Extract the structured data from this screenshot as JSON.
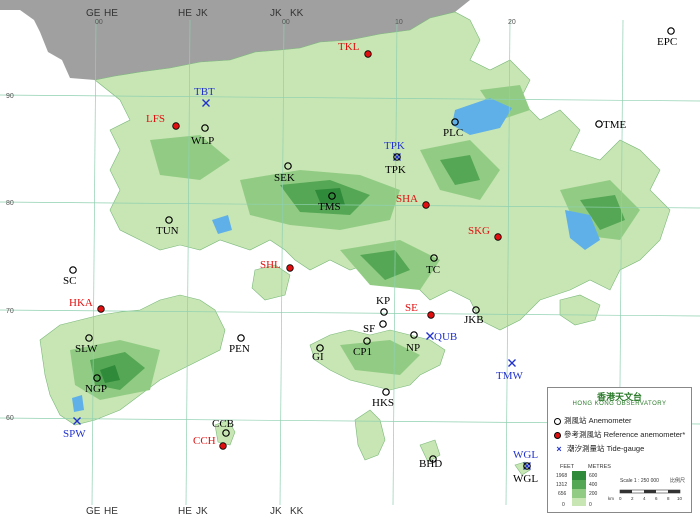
{
  "map": {
    "colors": {
      "sea": "#ffffff",
      "mainland": "#a0a0a0",
      "land_low": "#c8e6b4",
      "land_mid": "#92cc84",
      "land_high": "#55a755",
      "land_peak": "#2f8a3a",
      "reservoir": "#5fb0e8",
      "grid": "#8fd0b0",
      "anemometer": "#000000",
      "reference": "#e01010",
      "tide": "#2233cc"
    },
    "grid_top_labels": [
      "GE",
      "HE",
      "HE",
      "JK",
      "JK",
      "KK"
    ],
    "grid_bottom_labels": [
      "GE",
      "HE",
      "HE",
      "JK",
      "JK",
      "KK"
    ],
    "grid_numbers_left": [
      "90",
      "80",
      "70",
      "60"
    ],
    "grid_numbers_top": [
      "00",
      "00",
      "10",
      "20"
    ],
    "stations": [
      {
        "code": "TKL",
        "type": "reference"
      },
      {
        "code": "EPC",
        "type": "anemometer"
      },
      {
        "code": "TBT",
        "type": "tide"
      },
      {
        "code": "LFS",
        "type": "reference"
      },
      {
        "code": "WLP",
        "type": "anemometer"
      },
      {
        "code": "PLC",
        "type": "anemometer"
      },
      {
        "code": "TME",
        "type": "anemometer"
      },
      {
        "code": "TPK",
        "type": "tide"
      },
      {
        "code": "TPK",
        "type": "anemometer"
      },
      {
        "code": "SEK",
        "type": "anemometer"
      },
      {
        "code": "TMS",
        "type": "anemometer"
      },
      {
        "code": "SHA",
        "type": "reference"
      },
      {
        "code": "TUN",
        "type": "anemometer"
      },
      {
        "code": "SKG",
        "type": "reference"
      },
      {
        "code": "SHL",
        "type": "reference"
      },
      {
        "code": "TC",
        "type": "anemometer"
      },
      {
        "code": "SC",
        "type": "anemometer"
      },
      {
        "code": "HKA",
        "type": "reference"
      },
      {
        "code": "KP",
        "type": "anemometer"
      },
      {
        "code": "SE",
        "type": "reference"
      },
      {
        "code": "JKB",
        "type": "anemometer"
      },
      {
        "code": "SF",
        "type": "anemometer"
      },
      {
        "code": "QUB",
        "type": "tide"
      },
      {
        "code": "NP",
        "type": "anemometer"
      },
      {
        "code": "SLW",
        "type": "anemometer"
      },
      {
        "code": "PEN",
        "type": "anemometer"
      },
      {
        "code": "GI",
        "type": "anemometer"
      },
      {
        "code": "CP1",
        "type": "anemometer"
      },
      {
        "code": "NGP",
        "type": "anemometer"
      },
      {
        "code": "TMW",
        "type": "tide"
      },
      {
        "code": "HKS",
        "type": "anemometer"
      },
      {
        "code": "SPW",
        "type": "tide"
      },
      {
        "code": "CCB",
        "type": "anemometer"
      },
      {
        "code": "CCH",
        "type": "reference"
      },
      {
        "code": "BHD",
        "type": "anemometer"
      },
      {
        "code": "WGL",
        "type": "tide"
      },
      {
        "code": "WGL",
        "type": "anemometer"
      }
    ]
  },
  "legend": {
    "title_zh": "香港天文台",
    "title_en": "HONG KONG OBSERVATORY",
    "anemometer": "測風站 Anemometer",
    "reference": "參考測風站 Reference anemometer*",
    "tide": "潮汐測量站 Tide-gauge",
    "feet_label": "FEET",
    "metres_label": "METRES",
    "feet_values": [
      "1968",
      "1312",
      "656",
      "0"
    ],
    "metre_values": [
      "600",
      "400",
      "200",
      "0"
    ],
    "scale": "Scale 1 : 250 000",
    "scale_zh": "比例尺",
    "scale_km": "km",
    "scale_ticks": [
      "0",
      "2",
      "4",
      "6",
      "8",
      "10"
    ]
  }
}
